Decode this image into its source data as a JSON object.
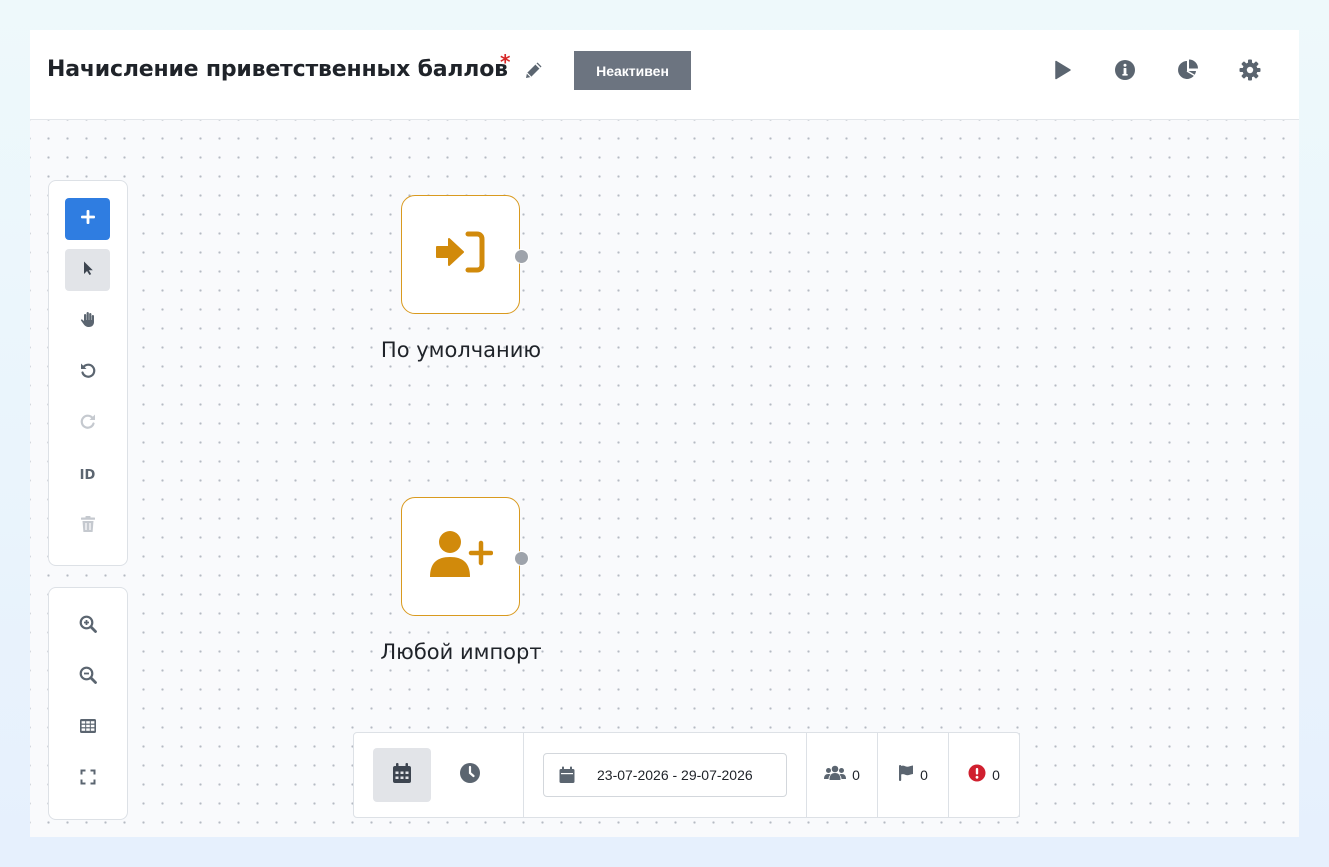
{
  "header": {
    "title": "Начисление приветственных баллов",
    "required_mark": "*",
    "status": "Неактивен",
    "actions": [
      {
        "name": "run",
        "icon": "play-icon"
      },
      {
        "name": "info",
        "icon": "info-icon"
      },
      {
        "name": "analytics",
        "icon": "pie-chart-icon"
      },
      {
        "name": "settings",
        "icon": "gear-icon"
      }
    ]
  },
  "toolbar": {
    "tools": [
      {
        "name": "add",
        "icon": "plus-icon",
        "state": "primary"
      },
      {
        "name": "select",
        "icon": "pointer-icon",
        "state": "active"
      },
      {
        "name": "pan",
        "icon": "hand-icon",
        "state": "normal"
      },
      {
        "name": "undo",
        "icon": "undo-icon",
        "state": "normal"
      },
      {
        "name": "redo",
        "icon": "redo-icon",
        "state": "disabled"
      },
      {
        "name": "id",
        "label": "ID",
        "state": "normal"
      },
      {
        "name": "delete",
        "icon": "trash-icon",
        "state": "disabled"
      }
    ],
    "view_tools": [
      {
        "name": "zoom-in",
        "icon": "zoom-in-icon"
      },
      {
        "name": "zoom-out",
        "icon": "zoom-out-icon"
      },
      {
        "name": "grid",
        "icon": "grid-icon"
      },
      {
        "name": "fit",
        "icon": "fullscreen-icon"
      }
    ]
  },
  "nodes": [
    {
      "label": "По умолчанию",
      "icon": "sign-in-icon"
    },
    {
      "label": "Любой импорт",
      "icon": "user-plus-icon"
    }
  ],
  "bottom": {
    "mode": "calendar",
    "date_range": "23-07-2026 - 29-07-2026",
    "stats": [
      {
        "icon": "users-icon",
        "value": "0"
      },
      {
        "icon": "flag-icon",
        "value": "0"
      },
      {
        "icon": "error-icon",
        "value": "0",
        "color": "#d0202f"
      }
    ]
  },
  "colors": {
    "accent": "#2f7de1",
    "node_border": "#d99a1f",
    "node_icon": "#d18a0b",
    "badge": "#6c7480",
    "error": "#d0202f"
  }
}
